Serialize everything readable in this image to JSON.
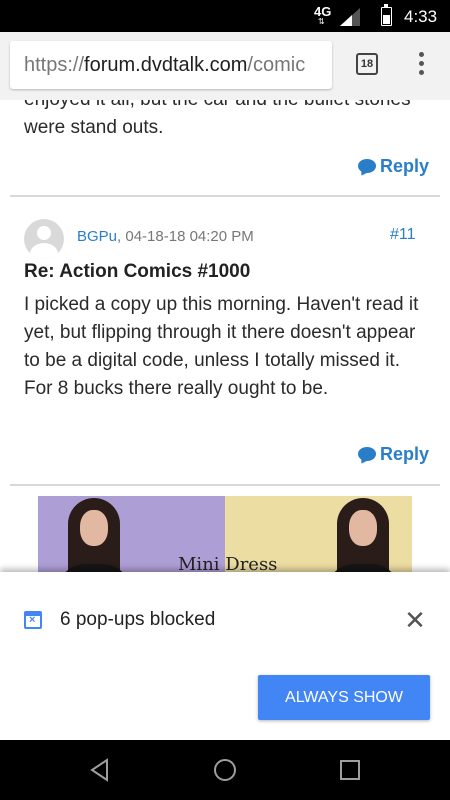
{
  "status_bar": {
    "network": "4G",
    "network_arrows": "⇅",
    "time": "4:33",
    "icons": [
      "signal-icon",
      "battery-icon"
    ]
  },
  "browser": {
    "url_scheme": "https://",
    "url_host": "forum.dvdtalk.com",
    "url_path": "/comic",
    "tab_count": "18",
    "icons": [
      "tab-switcher-icon",
      "menu-icon"
    ]
  },
  "thread": {
    "previous_post": {
      "text": "enjoyed it all, but the car and the bullet stories were stand outs.",
      "reply_label": "Reply"
    },
    "post": {
      "author": "BGPu",
      "date": ", 04-18-18 04:20 PM",
      "number": "#11",
      "title": "Re: Action Comics #1000",
      "body": "I picked a copy up this morning. Haven't read it yet, but flipping through it there doesn't appear to be a digital code, unless I totally missed it. For 8 bucks there really ought to be.",
      "reply_label": "Reply"
    },
    "ad": {
      "text": "Mini Dress",
      "colors": {
        "left_panel": "#ae9ed6",
        "right_panel": "#ecdda2"
      }
    }
  },
  "infobar": {
    "message": "6 pop-ups blocked",
    "button_label": "ALWAYS SHOW",
    "icon": "popup-blocked-icon"
  },
  "colors": {
    "accent": "#2a7ec8",
    "button": "#4285f4"
  }
}
